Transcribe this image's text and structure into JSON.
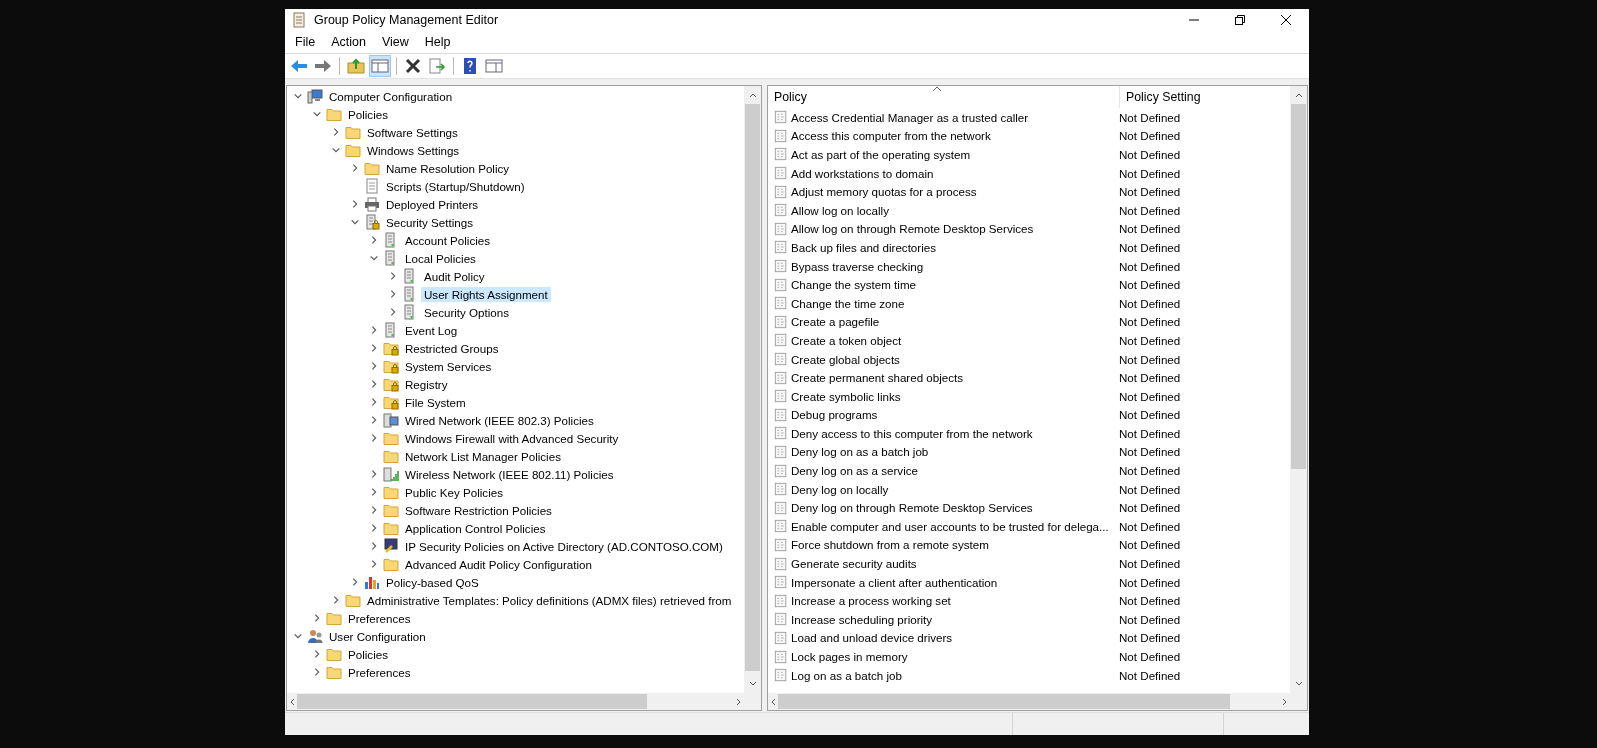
{
  "window": {
    "title": "Group Policy Management Editor"
  },
  "menu": [
    "File",
    "Action",
    "View",
    "Help"
  ],
  "tree": [
    {
      "label": "Computer Configuration",
      "kind": "computer",
      "expanded": true,
      "selected": false,
      "children": [
        {
          "label": "Policies",
          "kind": "folder",
          "expanded": true,
          "selected": false,
          "children": [
            {
              "label": "Software Settings",
              "kind": "folder",
              "expanded": false,
              "selected": false
            },
            {
              "label": "Windows Settings",
              "kind": "folder",
              "expanded": true,
              "selected": false,
              "children": [
                {
                  "label": "Name Resolution Policy",
                  "kind": "folder",
                  "expanded": false,
                  "selected": false
                },
                {
                  "label": "Scripts (Startup/Shutdown)",
                  "kind": "script",
                  "selected": false
                },
                {
                  "label": "Deployed Printers",
                  "kind": "printer",
                  "expanded": false,
                  "selected": false
                },
                {
                  "label": "Security Settings",
                  "kind": "server-lock",
                  "expanded": true,
                  "selected": false,
                  "children": [
                    {
                      "label": "Account Policies",
                      "kind": "server",
                      "expanded": false,
                      "selected": false
                    },
                    {
                      "label": "Local Policies",
                      "kind": "server",
                      "expanded": true,
                      "selected": false,
                      "children": [
                        {
                          "label": "Audit Policy",
                          "kind": "server",
                          "expanded": false,
                          "selected": false
                        },
                        {
                          "label": "User Rights Assignment",
                          "kind": "server",
                          "expanded": false,
                          "selected": true
                        },
                        {
                          "label": "Security Options",
                          "kind": "server",
                          "expanded": false,
                          "selected": false
                        }
                      ]
                    },
                    {
                      "label": "Event Log",
                      "kind": "server",
                      "expanded": false,
                      "selected": false
                    },
                    {
                      "label": "Restricted Groups",
                      "kind": "folder-lock",
                      "expanded": false,
                      "selected": false
                    },
                    {
                      "label": "System Services",
                      "kind": "folder-lock",
                      "expanded": false,
                      "selected": false
                    },
                    {
                      "label": "Registry",
                      "kind": "folder-lock",
                      "expanded": false,
                      "selected": false
                    },
                    {
                      "label": "File System",
                      "kind": "folder-lock",
                      "expanded": false,
                      "selected": false
                    },
                    {
                      "label": "Wired Network (IEEE 802.3) Policies",
                      "kind": "wired",
                      "expanded": false,
                      "selected": false
                    },
                    {
                      "label": "Windows Firewall with Advanced Security",
                      "kind": "folder",
                      "expanded": false,
                      "selected": false
                    },
                    {
                      "label": "Network List Manager Policies",
                      "kind": "folder",
                      "selected": false
                    },
                    {
                      "label": "Wireless Network (IEEE 802.11) Policies",
                      "kind": "wireless",
                      "expanded": false,
                      "selected": false
                    },
                    {
                      "label": "Public Key Policies",
                      "kind": "folder",
                      "expanded": false,
                      "selected": false
                    },
                    {
                      "label": "Software Restriction Policies",
                      "kind": "folder",
                      "expanded": false,
                      "selected": false
                    },
                    {
                      "label": "Application Control Policies",
                      "kind": "folder",
                      "expanded": false,
                      "selected": false
                    },
                    {
                      "label": "IP Security Policies on Active Directory (AD.CONTOSO.COM)",
                      "kind": "ipsec",
                      "expanded": false,
                      "selected": false
                    },
                    {
                      "label": "Advanced Audit Policy Configuration",
                      "kind": "folder",
                      "expanded": false,
                      "selected": false
                    }
                  ]
                },
                {
                  "label": "Policy-based QoS",
                  "kind": "qos",
                  "expanded": false,
                  "selected": false
                }
              ]
            },
            {
              "label": "Administrative Templates: Policy definitions (ADMX files) retrieved from",
              "kind": "folder",
              "expanded": false,
              "selected": false
            }
          ]
        },
        {
          "label": "Preferences",
          "kind": "folder",
          "expanded": false,
          "selected": false
        }
      ]
    },
    {
      "label": "User Configuration",
      "kind": "user",
      "expanded": true,
      "selected": false,
      "children": [
        {
          "label": "Policies",
          "kind": "folder",
          "expanded": false,
          "selected": false
        },
        {
          "label": "Preferences",
          "kind": "folder",
          "expanded": false,
          "selected": false
        }
      ]
    }
  ],
  "table": {
    "columns": [
      "Policy",
      "Policy Setting"
    ],
    "rows": [
      [
        "Access Credential Manager as a trusted caller",
        "Not Defined"
      ],
      [
        "Access this computer from the network",
        "Not Defined"
      ],
      [
        "Act as part of the operating system",
        "Not Defined"
      ],
      [
        "Add workstations to domain",
        "Not Defined"
      ],
      [
        "Adjust memory quotas for a process",
        "Not Defined"
      ],
      [
        "Allow log on locally",
        "Not Defined"
      ],
      [
        "Allow log on through Remote Desktop Services",
        "Not Defined"
      ],
      [
        "Back up files and directories",
        "Not Defined"
      ],
      [
        "Bypass traverse checking",
        "Not Defined"
      ],
      [
        "Change the system time",
        "Not Defined"
      ],
      [
        "Change the time zone",
        "Not Defined"
      ],
      [
        "Create a pagefile",
        "Not Defined"
      ],
      [
        "Create a token object",
        "Not Defined"
      ],
      [
        "Create global objects",
        "Not Defined"
      ],
      [
        "Create permanent shared objects",
        "Not Defined"
      ],
      [
        "Create symbolic links",
        "Not Defined"
      ],
      [
        "Debug programs",
        "Not Defined"
      ],
      [
        "Deny access to this computer from the network",
        "Not Defined"
      ],
      [
        "Deny log on as a batch job",
        "Not Defined"
      ],
      [
        "Deny log on as a service",
        "Not Defined"
      ],
      [
        "Deny log on locally",
        "Not Defined"
      ],
      [
        "Deny log on through Remote Desktop Services",
        "Not Defined"
      ],
      [
        "Enable computer and user accounts to be trusted for delega...",
        "Not Defined"
      ],
      [
        "Force shutdown from a remote system",
        "Not Defined"
      ],
      [
        "Generate security audits",
        "Not Defined"
      ],
      [
        "Impersonate a client after authentication",
        "Not Defined"
      ],
      [
        "Increase a process working set",
        "Not Defined"
      ],
      [
        "Increase scheduling priority",
        "Not Defined"
      ],
      [
        "Load and unload device drivers",
        "Not Defined"
      ],
      [
        "Lock pages in memory",
        "Not Defined"
      ],
      [
        "Log on as a batch job",
        "Not Defined"
      ]
    ]
  }
}
